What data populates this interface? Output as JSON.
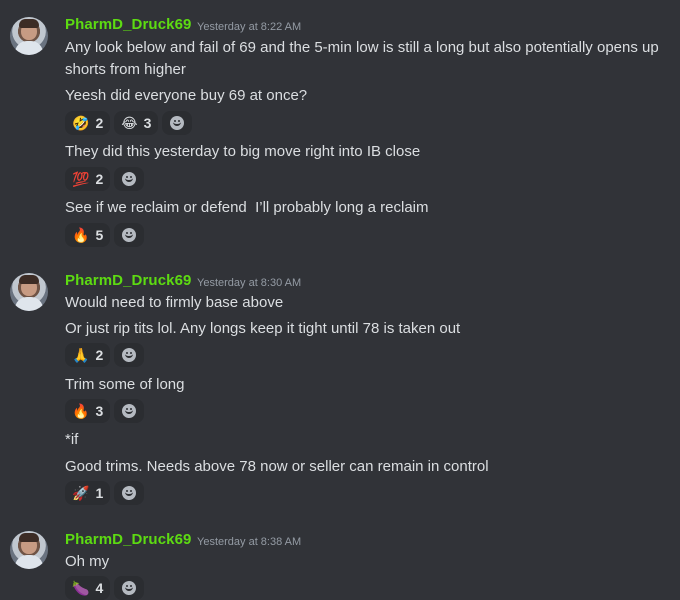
{
  "groups": [
    {
      "author": "PharmD_Druck69",
      "timestamp": "Yesterday at 8:22 AM",
      "messages": [
        {
          "text": "Any look below and fail of 69 and the 5-min low is still a long but also potentially opens up shorts from higher"
        },
        {
          "text": "Yeesh did everyone buy 69 at once?",
          "reactions": [
            {
              "emoji": "🤣",
              "count": "2"
            },
            {
              "emoji": "😂",
              "count": "3"
            }
          ]
        },
        {
          "text": "They did this yesterday to big move right into IB close",
          "reactions": [
            {
              "emoji": "💯",
              "count": "2"
            }
          ]
        },
        {
          "text": "See if we reclaim or defend  I’ll probably long a reclaim",
          "reactions": [
            {
              "emoji": "🔥",
              "count": "5"
            }
          ]
        }
      ]
    },
    {
      "author": "PharmD_Druck69",
      "timestamp": "Yesterday at 8:30 AM",
      "messages": [
        {
          "text": "Would need to firmly base above"
        },
        {
          "text": "Or just rip tits lol. Any longs keep it tight until 78 is taken out",
          "reactions": [
            {
              "emoji": "🙏",
              "count": "2"
            }
          ]
        },
        {
          "text": "Trim some of long",
          "reactions": [
            {
              "emoji": "🔥",
              "count": "3"
            }
          ]
        },
        {
          "text": "*if"
        },
        {
          "text": "Good trims. Needs above 78 now or seller can remain in control",
          "reactions": [
            {
              "emoji": "🚀",
              "count": "1"
            }
          ]
        }
      ]
    },
    {
      "author": "PharmD_Druck69",
      "timestamp": "Yesterday at 8:38 AM",
      "messages": [
        {
          "text": "Oh my",
          "reactions": [
            {
              "emoji": "🍆",
              "count": "4"
            }
          ]
        }
      ]
    }
  ],
  "icons": {
    "add_reaction": "add-reaction-icon",
    "avatar": "user-avatar"
  },
  "colors": {
    "background": "#313338",
    "username": "#5ddb12",
    "timestamp": "#949ba4",
    "reaction_bg": "#2b2d31"
  }
}
